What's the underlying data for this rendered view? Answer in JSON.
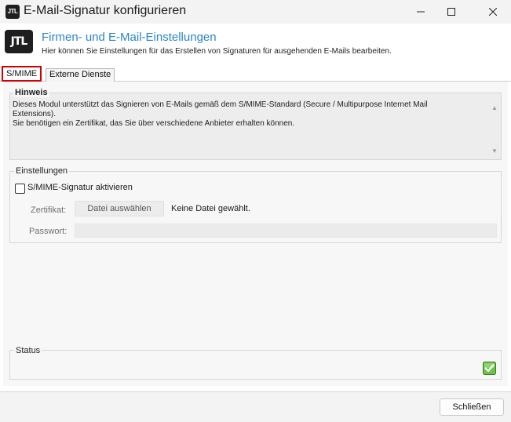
{
  "window": {
    "title": "E-Mail-Signatur konfigurieren",
    "app_icon_text": "JTL",
    "controls": [
      "minimize-icon",
      "maximize-icon",
      "close-icon"
    ]
  },
  "header": {
    "logo_text": "JTL",
    "title": "Firmen- und E-Mail-Einstellungen",
    "subtitle": "Hier können Sie Einstellungen für das Erstellen von Signaturen für ausgehenden E-Mails bearbeiten."
  },
  "tabs": [
    {
      "label": "S/MIME",
      "active": true
    },
    {
      "label": "Externe Dienste",
      "active": false
    }
  ],
  "hinweis": {
    "label": "Hinweis",
    "line1": "Dieses Modul unterstützt das Signieren von E-Mails gemäß dem S/MIME-Standard (Secure / Multipurpose Internet Mail",
    "line2": "Extensions).",
    "line3": "Sie benötigen ein Zertifikat, das Sie über verschiedene Anbieter erhalten können.",
    "scroll_up_glyph": "▲",
    "scroll_down_glyph": "▼"
  },
  "settings": {
    "label": "Einstellungen",
    "checkbox_label": "S/MIME-Signatur aktivieren",
    "checkbox_checked": false,
    "certificate_label": "Zertifikat:",
    "file_button_label": "Datei auswählen",
    "file_status": "Keine Datei gewählt.",
    "password_label": "Passwort:",
    "password_value": ""
  },
  "status": {
    "label": "Status",
    "icon": "green-check-icon",
    "icon_color": "#3c9a2b"
  },
  "footer": {
    "close_button_label": "Schließen"
  },
  "colors": {
    "header_title": "#2a86c9",
    "active_tab_border": "#d00000"
  }
}
